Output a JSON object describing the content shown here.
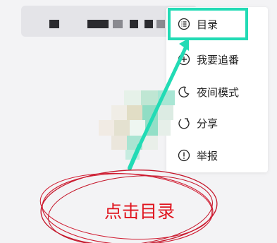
{
  "menu": {
    "items": [
      {
        "label": "目录",
        "icon": "list-icon"
      },
      {
        "label": "我要追番",
        "icon": "plus-circle-icon"
      },
      {
        "label": "夜间模式",
        "icon": "moon-icon"
      },
      {
        "label": "分享",
        "icon": "share-icon"
      },
      {
        "label": "举报",
        "icon": "alert-circle-icon"
      }
    ]
  },
  "annotation": {
    "text": "点击目录",
    "highlight_color": "#22dbb5",
    "ink_color": "#e0141e"
  }
}
